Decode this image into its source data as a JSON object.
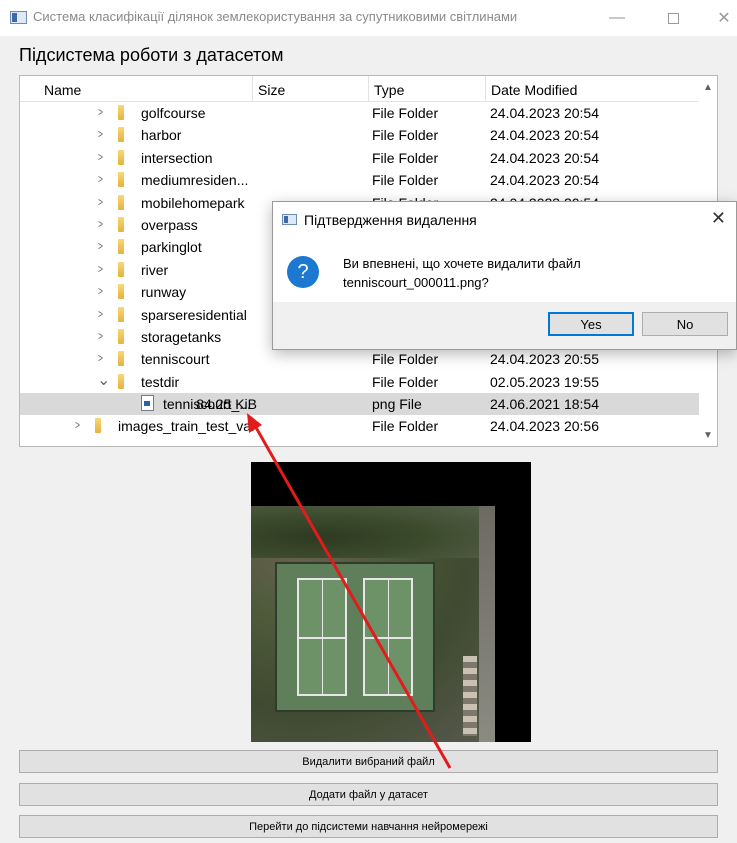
{
  "window": {
    "title": "Система класифікації ділянок землекористування за супутниковими світлинами",
    "minimize_icon": "minimize-icon",
    "maximize_icon": "maximize-icon",
    "close_icon": "close-icon"
  },
  "section_title": "Підсистема роботи з датасетом",
  "tree": {
    "headers": {
      "name": "Name",
      "size": "Size",
      "type": "Type",
      "date": "Date Modified"
    },
    "rows": [
      {
        "name": "golfcourse",
        "size": "",
        "type": "File Folder",
        "date": "24.04.2023 20:54",
        "level": 1,
        "kind": "folder",
        "expanded": false
      },
      {
        "name": "harbor",
        "size": "",
        "type": "File Folder",
        "date": "24.04.2023 20:54",
        "level": 1,
        "kind": "folder",
        "expanded": false
      },
      {
        "name": "intersection",
        "size": "",
        "type": "File Folder",
        "date": "24.04.2023 20:54",
        "level": 1,
        "kind": "folder",
        "expanded": false
      },
      {
        "name": "mediumresiden...",
        "size": "",
        "type": "File Folder",
        "date": "24.04.2023 20:54",
        "level": 1,
        "kind": "folder",
        "expanded": false
      },
      {
        "name": "mobilehomepark",
        "size": "",
        "type": "File Folder",
        "date": "24.04.2023 20:54",
        "level": 1,
        "kind": "folder",
        "expanded": false
      },
      {
        "name": "overpass",
        "size": "",
        "type": "",
        "date": "",
        "level": 1,
        "kind": "folder",
        "expanded": false
      },
      {
        "name": "parkinglot",
        "size": "",
        "type": "",
        "date": "",
        "level": 1,
        "kind": "folder",
        "expanded": false
      },
      {
        "name": "river",
        "size": "",
        "type": "",
        "date": "",
        "level": 1,
        "kind": "folder",
        "expanded": false
      },
      {
        "name": "runway",
        "size": "",
        "type": "",
        "date": "",
        "level": 1,
        "kind": "folder",
        "expanded": false
      },
      {
        "name": "sparseresidential",
        "size": "",
        "type": "",
        "date": "",
        "level": 1,
        "kind": "folder",
        "expanded": false
      },
      {
        "name": "storagetanks",
        "size": "",
        "type": "",
        "date": "",
        "level": 1,
        "kind": "folder",
        "expanded": false
      },
      {
        "name": "tenniscourt",
        "size": "",
        "type": "File Folder",
        "date": "24.04.2023 20:55",
        "level": 1,
        "kind": "folder",
        "expanded": false
      },
      {
        "name": "testdir",
        "size": "",
        "type": "File Folder",
        "date": "02.05.2023 19:55",
        "level": 1,
        "kind": "folder",
        "expanded": true
      },
      {
        "name": "tenniscourt_...",
        "size": "84.25 KiB",
        "type": "png File",
        "date": "24.06.2021 18:54",
        "level": 2,
        "kind": "file",
        "selected": true
      },
      {
        "name": "images_train_test_val",
        "size": "",
        "type": "File Folder",
        "date": "24.04.2023 20:56",
        "level": 0,
        "kind": "folder",
        "expanded": false
      }
    ]
  },
  "buttons": {
    "delete": "Видалити вибраний файл",
    "add": "Додати файл у датасет",
    "go_training": "Перейти до підсистеми навчання нейромережі"
  },
  "dialog": {
    "title": "Підтвердження видалення",
    "message_line1": "Ви впевнені, що хочете видалити файл",
    "message_line2": "tenniscourt_000011.png?",
    "yes": "Yes",
    "no": "No",
    "close": "✕",
    "question_mark": "?"
  },
  "colors": {
    "accent": "#0078d7",
    "arrow": "#e21b1b",
    "question_icon": "#1d78d1"
  }
}
